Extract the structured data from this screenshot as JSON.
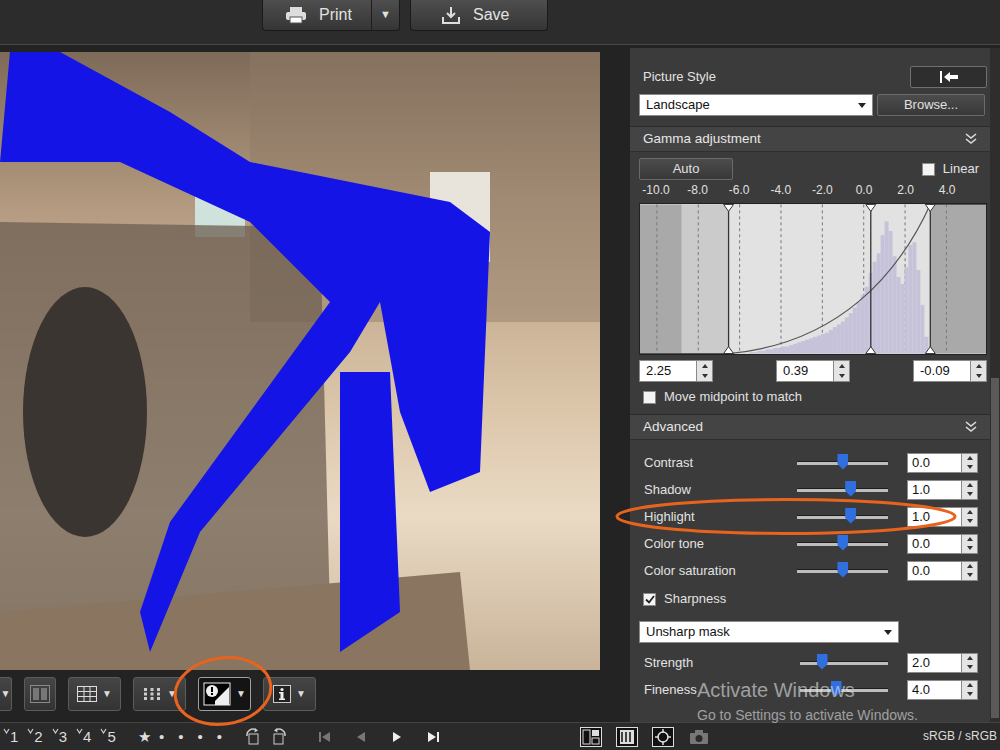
{
  "toolbar": {
    "print": {
      "label": "Print",
      "arrow": "▼"
    },
    "save": {
      "label": "Save"
    }
  },
  "view_toolbar": [
    {
      "kind": "menu",
      "arrow": "▼",
      "selected": false,
      "circled": false
    },
    {
      "kind": "compare",
      "selected": false,
      "circled": false
    },
    {
      "kind": "grid",
      "arrow": "▼",
      "selected": false,
      "circled": false
    },
    {
      "kind": "af",
      "arrow": "▼",
      "selected": false,
      "circled": false
    },
    {
      "kind": "warning",
      "arrow": "▼",
      "selected": true,
      "circled": true
    },
    {
      "kind": "info",
      "arrow": "▼",
      "selected": false,
      "circled": false
    }
  ],
  "panel": {
    "picture_style": {
      "title": "Picture Style",
      "value": "Landscape",
      "browse": "Browse..."
    },
    "gamma": {
      "title": "Gamma adjustment",
      "auto": "Auto",
      "linear": {
        "label": "Linear",
        "checked": false
      },
      "axis": [
        "-10.0",
        "-8.0",
        "-6.0",
        "-4.0",
        "-2.0",
        "0.0",
        "2.0",
        "4.0"
      ],
      "histogram": [
        0,
        0,
        1,
        1,
        2,
        2,
        3,
        3,
        4,
        4,
        5,
        5,
        6,
        7,
        8,
        9,
        10,
        11,
        12,
        13,
        14,
        15,
        17,
        19,
        21,
        23,
        26,
        29,
        33,
        37,
        42,
        48,
        58,
        66,
        72,
        85,
        95,
        88,
        70,
        55,
        50,
        62,
        78,
        80,
        60,
        35,
        12,
        3
      ],
      "markers": [
        {
          "level": 0.256
        },
        {
          "level": 0.667
        },
        {
          "level": 0.839
        }
      ],
      "inputs": [
        "2.25",
        "0.39",
        "-0.09"
      ],
      "move_midpoint": {
        "label": "Move midpoint to match",
        "checked": false
      }
    },
    "advanced": {
      "title": "Advanced",
      "sliders": [
        {
          "label": "Contrast",
          "value": "0.0",
          "level": 0.505,
          "circled": false
        },
        {
          "label": "Shadow",
          "value": "1.0",
          "level": 0.59,
          "circled": false
        },
        {
          "label": "Highlight",
          "value": "1.0",
          "level": 0.59,
          "circled": true
        },
        {
          "label": "Color tone",
          "value": "0.0",
          "level": 0.505,
          "circled": false
        },
        {
          "label": "Color saturation",
          "value": "0.0",
          "level": 0.505,
          "circled": false
        }
      ]
    },
    "sharpness": {
      "label": "Sharpness",
      "checked": true,
      "mode": "Unsharp mask",
      "sliders": [
        {
          "label": "Strength",
          "value": "2.0",
          "level": 0.25,
          "circled": false
        },
        {
          "label": "Fineness",
          "value": "4.0",
          "level": 0.41,
          "circled": false
        }
      ]
    }
  },
  "status_bar": {
    "checks": [
      "1",
      "2",
      "3",
      "4",
      "5"
    ],
    "star": "★",
    "dots": [
      "•",
      "•",
      "•",
      "•"
    ],
    "nav": [
      {
        "kind": "first",
        "disabled": true
      },
      {
        "kind": "prev",
        "disabled": true
      },
      {
        "kind": "next",
        "disabled": false
      },
      {
        "kind": "last",
        "disabled": false
      }
    ],
    "color_space": "sRGB / sRGB"
  },
  "watermark": {
    "title": "Activate Windows",
    "subtitle": "Go to Settings to activate Windows."
  }
}
